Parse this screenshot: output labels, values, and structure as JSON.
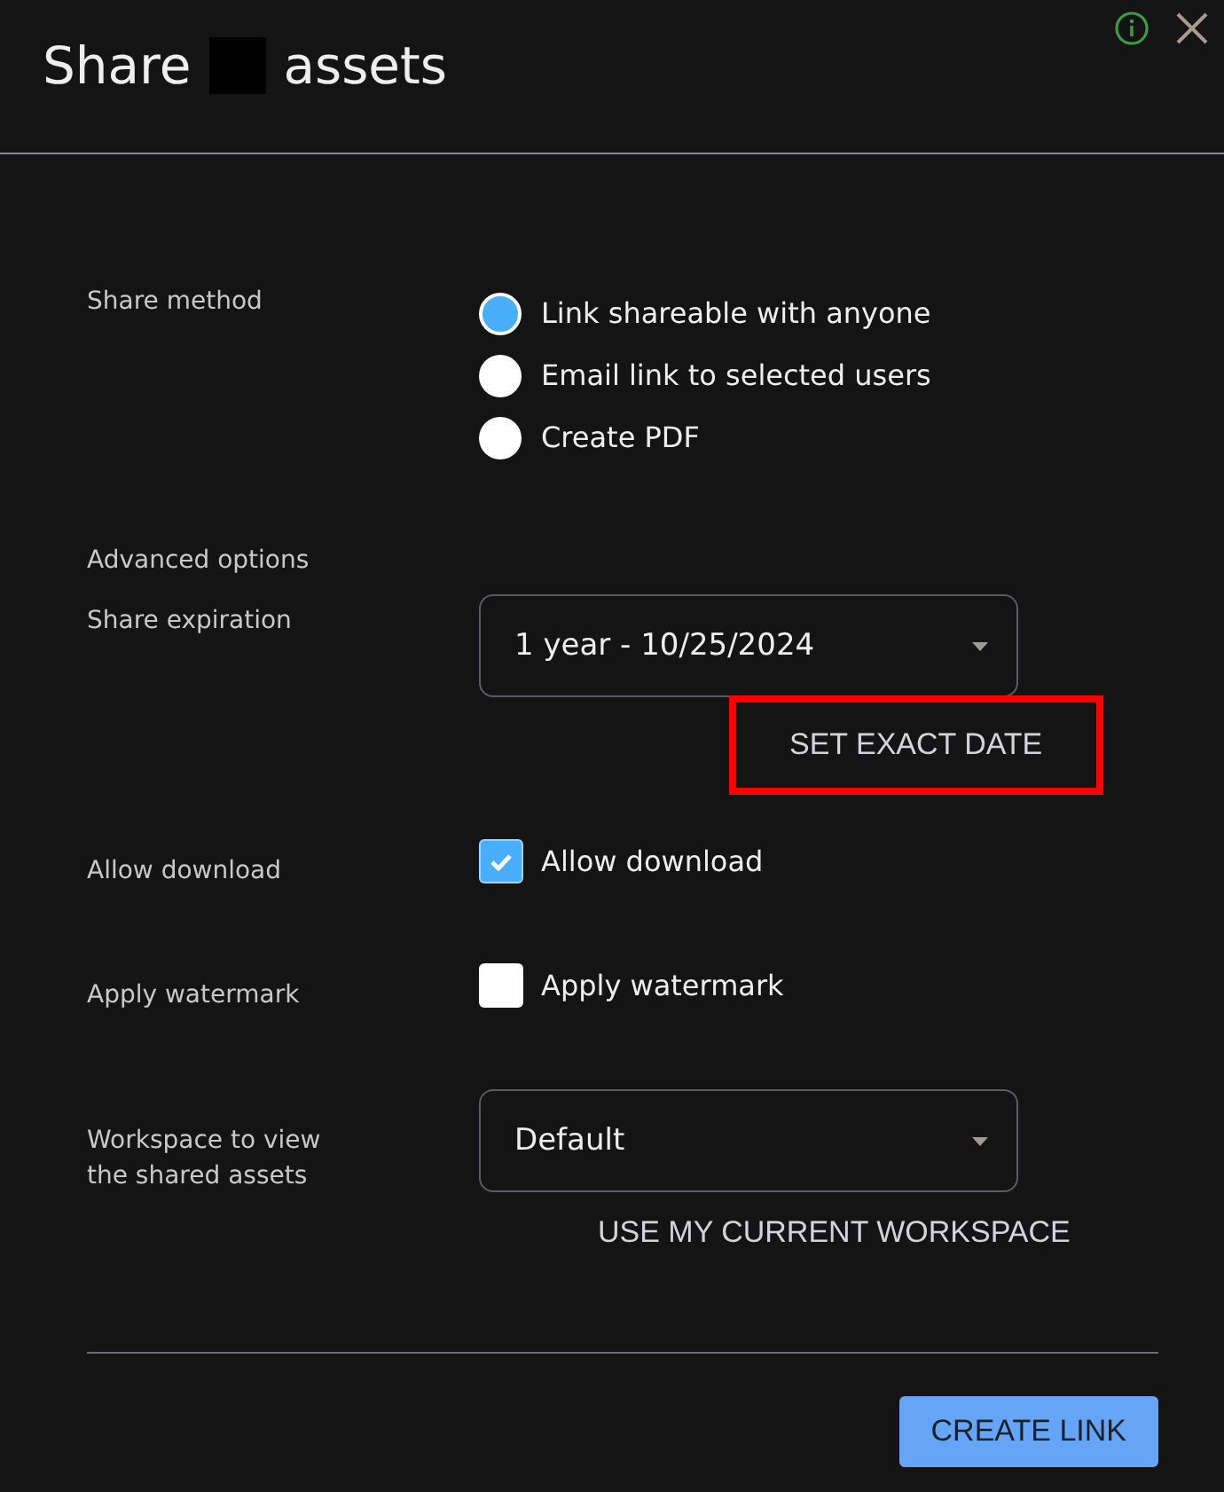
{
  "dialog": {
    "title_before": "Share",
    "title_redacted": true,
    "title_after": "assets"
  },
  "share_method": {
    "label": "Share method",
    "options": [
      {
        "label": "Link shareable with anyone",
        "selected": true
      },
      {
        "label": "Email link to selected users",
        "selected": false
      },
      {
        "label": "Create PDF",
        "selected": false
      }
    ]
  },
  "advanced_options": {
    "label": "Advanced options"
  },
  "share_expiration": {
    "label": "Share expiration",
    "value": "1 year - 10/25/2024",
    "button": {
      "label": "SET EXACT DATE",
      "highlighted": true
    }
  },
  "allow_download": {
    "label": "Allow download",
    "checkbox_label": "Allow download",
    "checked": true
  },
  "apply_watermark": {
    "label": "Apply watermark",
    "checkbox_label": "Apply watermark",
    "checked": false
  },
  "workspace": {
    "label_lines": [
      "Workspace to view",
      "the shared assets"
    ],
    "value": "Default",
    "button": {
      "label": "USE MY CURRENT WORKSPACE",
      "highlighted": false
    }
  },
  "create_button": "CREATE LINK"
}
